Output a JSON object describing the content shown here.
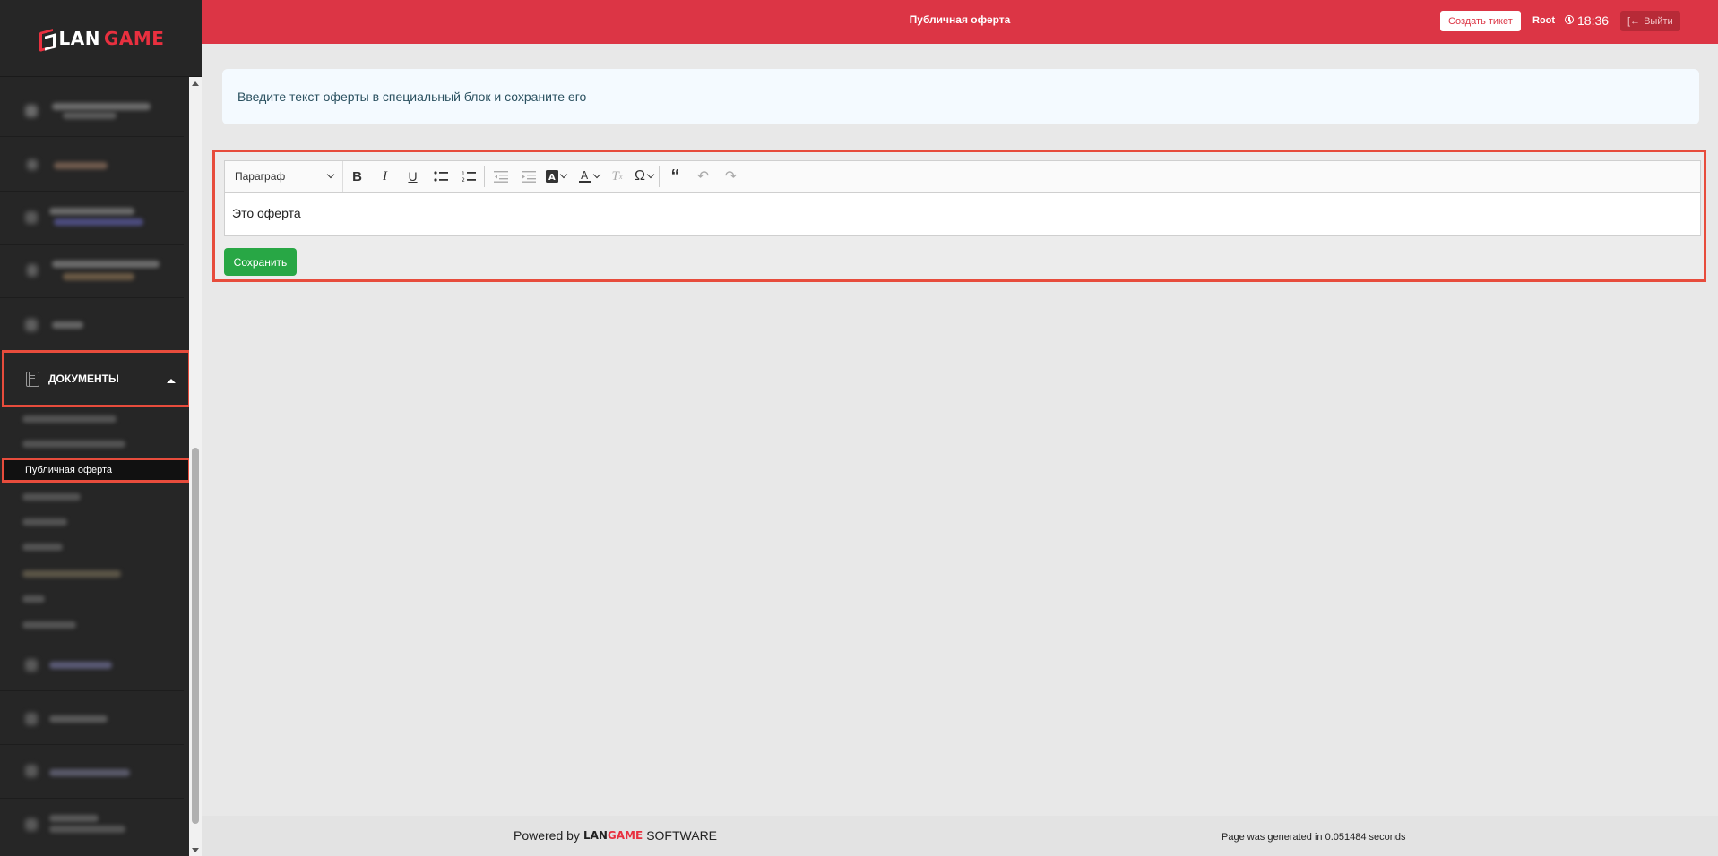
{
  "header": {
    "title": "Публичная оферта",
    "create_ticket": "Создать тикет",
    "user": "Root",
    "time": "18:36",
    "logout": "Выйти"
  },
  "sidebar": {
    "logo": {
      "part1": "LAN",
      "part2": "GAME"
    },
    "documents_label": "ДОКУМЕНТЫ",
    "active_subitem": "Публичная оферта"
  },
  "main": {
    "alert_text": "Введите текст оферты в специальный блок и сохраните его",
    "editor": {
      "block_format": "Параграф",
      "content": "Это оферта",
      "toolbar_icons": [
        "bold-icon",
        "italic-icon",
        "underline-icon",
        "bullet-list-icon",
        "numbered-list-icon",
        "outdent-icon",
        "indent-icon",
        "highlight-color-icon",
        "font-color-icon",
        "remove-format-icon",
        "special-character-icon",
        "blockquote-icon",
        "undo-icon",
        "redo-icon"
      ]
    },
    "save_label": "Сохранить"
  },
  "footer": {
    "powered_prefix": "Powered by",
    "brand_part1": "LAN",
    "brand_part2": "GAME",
    "powered_suffix": "SOFTWARE",
    "generated": "Page was generated in 0.051484 seconds"
  },
  "colors": {
    "header_bg": "#dc3545",
    "sidebar_bg": "#262626",
    "save_button": "#28a745",
    "highlight_border": "#e74c3c"
  }
}
